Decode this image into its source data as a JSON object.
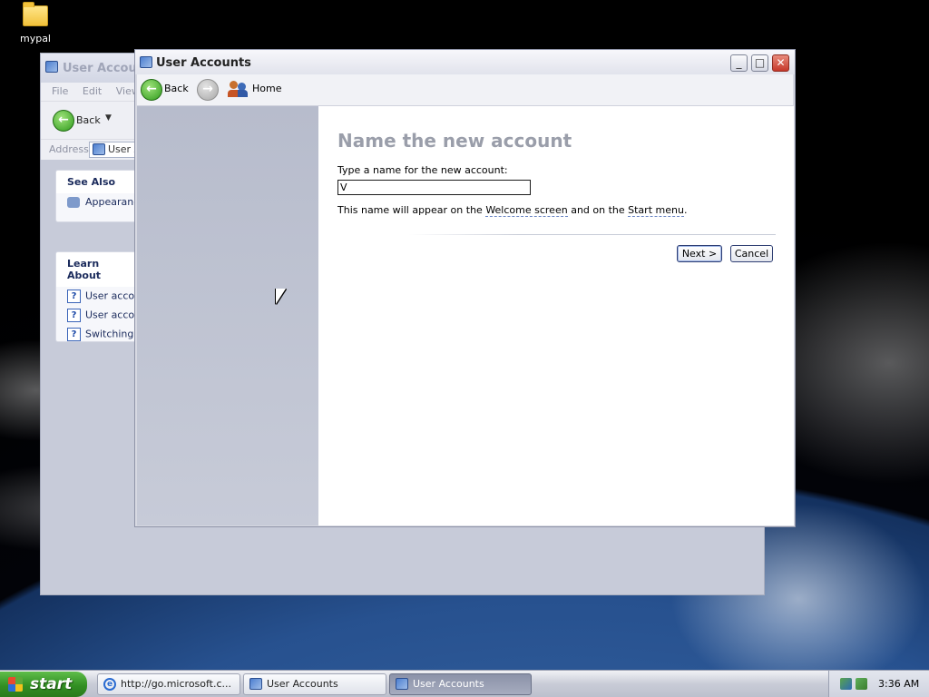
{
  "desktop": {
    "icons": [
      {
        "label": "mypal",
        "icon": "folder-icon"
      }
    ]
  },
  "background_window": {
    "title": "User Accounts",
    "menu": [
      "File",
      "Edit",
      "View"
    ],
    "toolbar": {
      "back_label": "Back"
    },
    "address": {
      "label": "Address",
      "value": "User A"
    },
    "see_also": {
      "title": "See Also",
      "items": [
        "Appearance"
      ]
    },
    "learn_about": {
      "title": "Learn About",
      "items": [
        "User accou",
        "User accou",
        "Switching u"
      ]
    }
  },
  "window": {
    "title": "User Accounts",
    "controls": {
      "minimize": "_",
      "maximize": "□",
      "close": "✕"
    },
    "nav": {
      "back_label": "Back",
      "home_label": "Home"
    },
    "content": {
      "heading": "Name the new account",
      "prompt": "Type a name for the new account:",
      "name_value": "V",
      "hint_before": "This name will appear on the ",
      "hint_link1": "Welcome screen",
      "hint_middle": " and on the ",
      "hint_link2": "Start menu",
      "hint_after": ".",
      "next_label": "Next >",
      "cancel_label": "Cancel"
    }
  },
  "taskbar": {
    "start_label": "start",
    "tasks": [
      {
        "label": "http://go.microsoft.c...",
        "icon": "ie-icon",
        "active": false
      },
      {
        "label": "User Accounts",
        "icon": "control-panel-icon",
        "active": false
      },
      {
        "label": "User Accounts",
        "icon": "user-accounts-icon",
        "active": true
      }
    ],
    "clock": "3:36 AM"
  },
  "colors": {
    "heading": "#9a9eaa",
    "start_button": "#3a9a2c",
    "active_task": "#8b92a8",
    "close_button": "#c6382a"
  }
}
